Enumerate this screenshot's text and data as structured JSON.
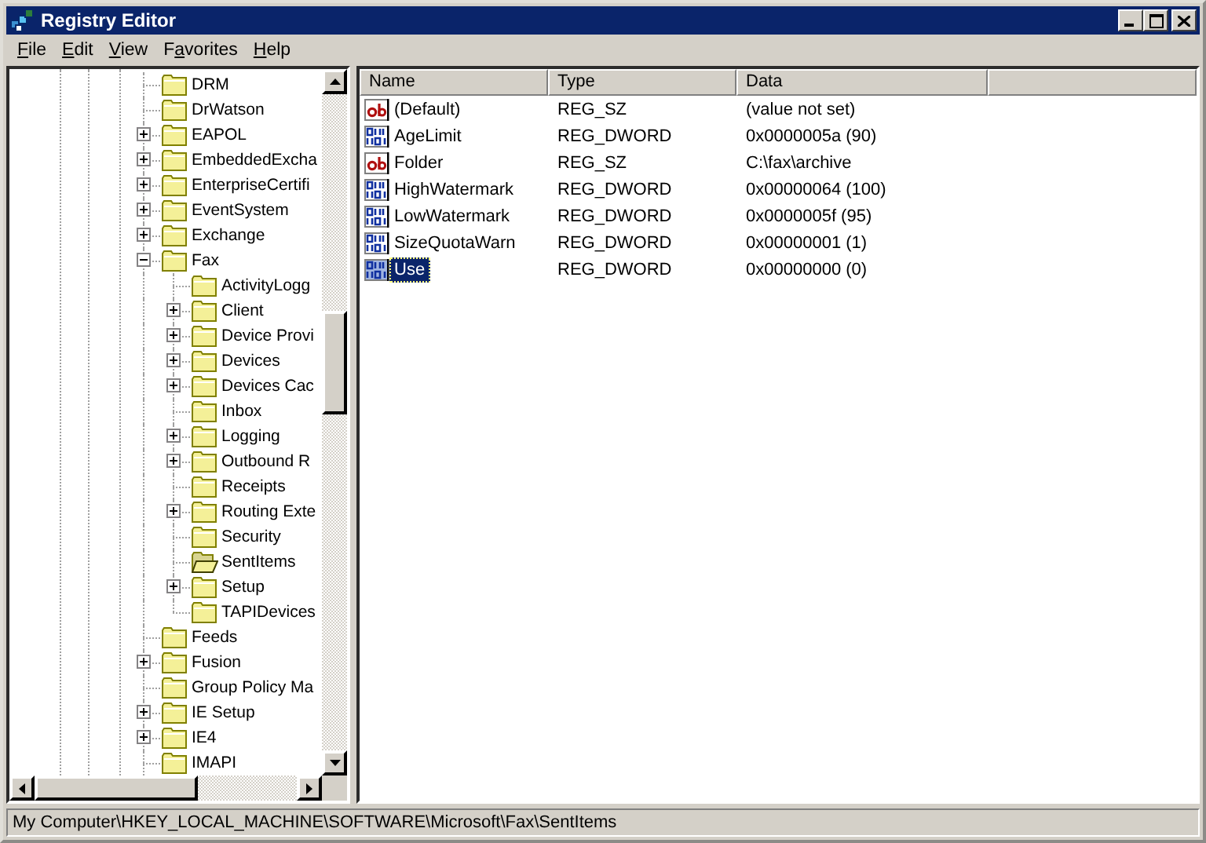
{
  "window": {
    "title": "Registry Editor"
  },
  "menu": [
    {
      "key": "F",
      "post": "ile"
    },
    {
      "key": "E",
      "post": "dit"
    },
    {
      "key": "V",
      "post": "iew"
    },
    {
      "pre": "F",
      "key": "a",
      "post": "vorites"
    },
    {
      "key": "H",
      "post": "elp"
    }
  ],
  "tree": [
    {
      "label": "DRM",
      "expandable": false,
      "selected": false
    },
    {
      "label": "DrWatson",
      "expandable": false,
      "selected": false
    },
    {
      "label": "EAPOL",
      "expandable": true,
      "expanded": false,
      "selected": false
    },
    {
      "label": "EmbeddedExcha",
      "expandable": true,
      "expanded": false,
      "selected": false
    },
    {
      "label": "EnterpriseCertifi",
      "expandable": true,
      "expanded": false,
      "selected": false
    },
    {
      "label": "EventSystem",
      "expandable": true,
      "expanded": false,
      "selected": false
    },
    {
      "label": "Exchange",
      "expandable": true,
      "expanded": false,
      "selected": false
    },
    {
      "label": "Fax",
      "expandable": true,
      "expanded": true,
      "selected": false,
      "children": [
        {
          "label": "ActivityLogg",
          "expandable": false,
          "selected": false
        },
        {
          "label": "Client",
          "expandable": true,
          "expanded": false,
          "selected": false
        },
        {
          "label": "Device Provi",
          "expandable": true,
          "expanded": false,
          "selected": false
        },
        {
          "label": "Devices",
          "expandable": true,
          "expanded": false,
          "selected": false
        },
        {
          "label": "Devices Cac",
          "expandable": true,
          "expanded": false,
          "selected": false
        },
        {
          "label": "Inbox",
          "expandable": false,
          "selected": false
        },
        {
          "label": "Logging",
          "expandable": true,
          "expanded": false,
          "selected": false
        },
        {
          "label": "Outbound R",
          "expandable": true,
          "expanded": false,
          "selected": false
        },
        {
          "label": "Receipts",
          "expandable": false,
          "selected": false
        },
        {
          "label": "Routing Exte",
          "expandable": true,
          "expanded": false,
          "selected": false
        },
        {
          "label": "Security",
          "expandable": false,
          "selected": false
        },
        {
          "label": "SentItems",
          "expandable": false,
          "selected": true
        },
        {
          "label": "Setup",
          "expandable": true,
          "expanded": false,
          "selected": false
        },
        {
          "label": "TAPIDevices",
          "expandable": false,
          "selected": false
        }
      ]
    },
    {
      "label": "Feeds",
      "expandable": false,
      "selected": false
    },
    {
      "label": "Fusion",
      "expandable": true,
      "expanded": false,
      "selected": false
    },
    {
      "label": "Group Policy Ma",
      "expandable": false,
      "selected": false
    },
    {
      "label": "IE Setup",
      "expandable": true,
      "expanded": false,
      "selected": false
    },
    {
      "label": "IE4",
      "expandable": true,
      "expanded": false,
      "selected": false
    },
    {
      "label": "IMAPI",
      "expandable": false,
      "selected": false
    }
  ],
  "values": {
    "columns": [
      "Name",
      "Type",
      "Data"
    ],
    "rows": [
      {
        "name": "(Default)",
        "type": "REG_SZ",
        "data": "(value not set)",
        "kind": "string",
        "selected": false
      },
      {
        "name": "AgeLimit",
        "type": "REG_DWORD",
        "data": "0x0000005a (90)",
        "kind": "dword",
        "selected": false
      },
      {
        "name": "Folder",
        "type": "REG_SZ",
        "data": "C:\\fax\\archive",
        "kind": "string",
        "selected": false
      },
      {
        "name": "HighWatermark",
        "type": "REG_DWORD",
        "data": "0x00000064 (100)",
        "kind": "dword",
        "selected": false
      },
      {
        "name": "LowWatermark",
        "type": "REG_DWORD",
        "data": "0x0000005f (95)",
        "kind": "dword",
        "selected": false
      },
      {
        "name": "SizeQuotaWarn",
        "type": "REG_DWORD",
        "data": "0x00000001 (1)",
        "kind": "dword",
        "selected": false
      },
      {
        "name": "Use",
        "type": "REG_DWORD",
        "data": "0x00000000 (0)",
        "kind": "dword",
        "selected": true
      }
    ]
  },
  "status_bar": "My Computer\\HKEY_LOCAL_MACHINE\\SOFTWARE\\Microsoft\\Fax\\SentItems"
}
